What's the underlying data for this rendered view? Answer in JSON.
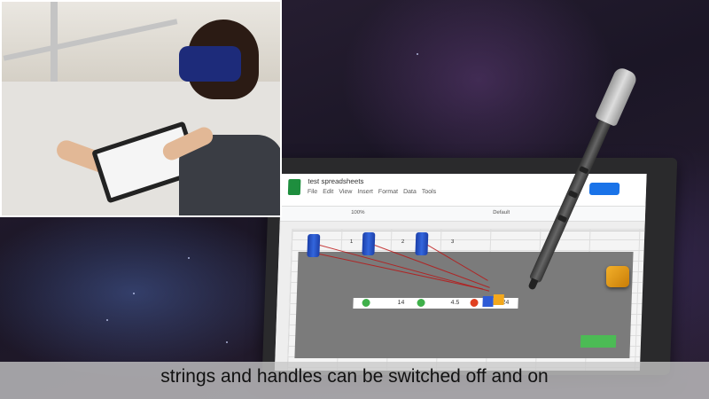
{
  "caption": "strings and handles can be switched off and on",
  "spreadsheet": {
    "title": "test spreadsheets",
    "menus": [
      "File",
      "Edit",
      "View",
      "Insert",
      "Format",
      "Data",
      "Tools"
    ],
    "zoom": "100%",
    "font": "Default",
    "data_values": [
      "14",
      "4.5",
      "24"
    ],
    "row_values": [
      "1",
      "2",
      "3"
    ]
  },
  "colors": {
    "handle_blue": "#2e5bd6",
    "string_red": "#b11",
    "green_dot": "#3fb04a",
    "orange_token": "#f3a81c",
    "green_rect": "#4cbb55"
  }
}
